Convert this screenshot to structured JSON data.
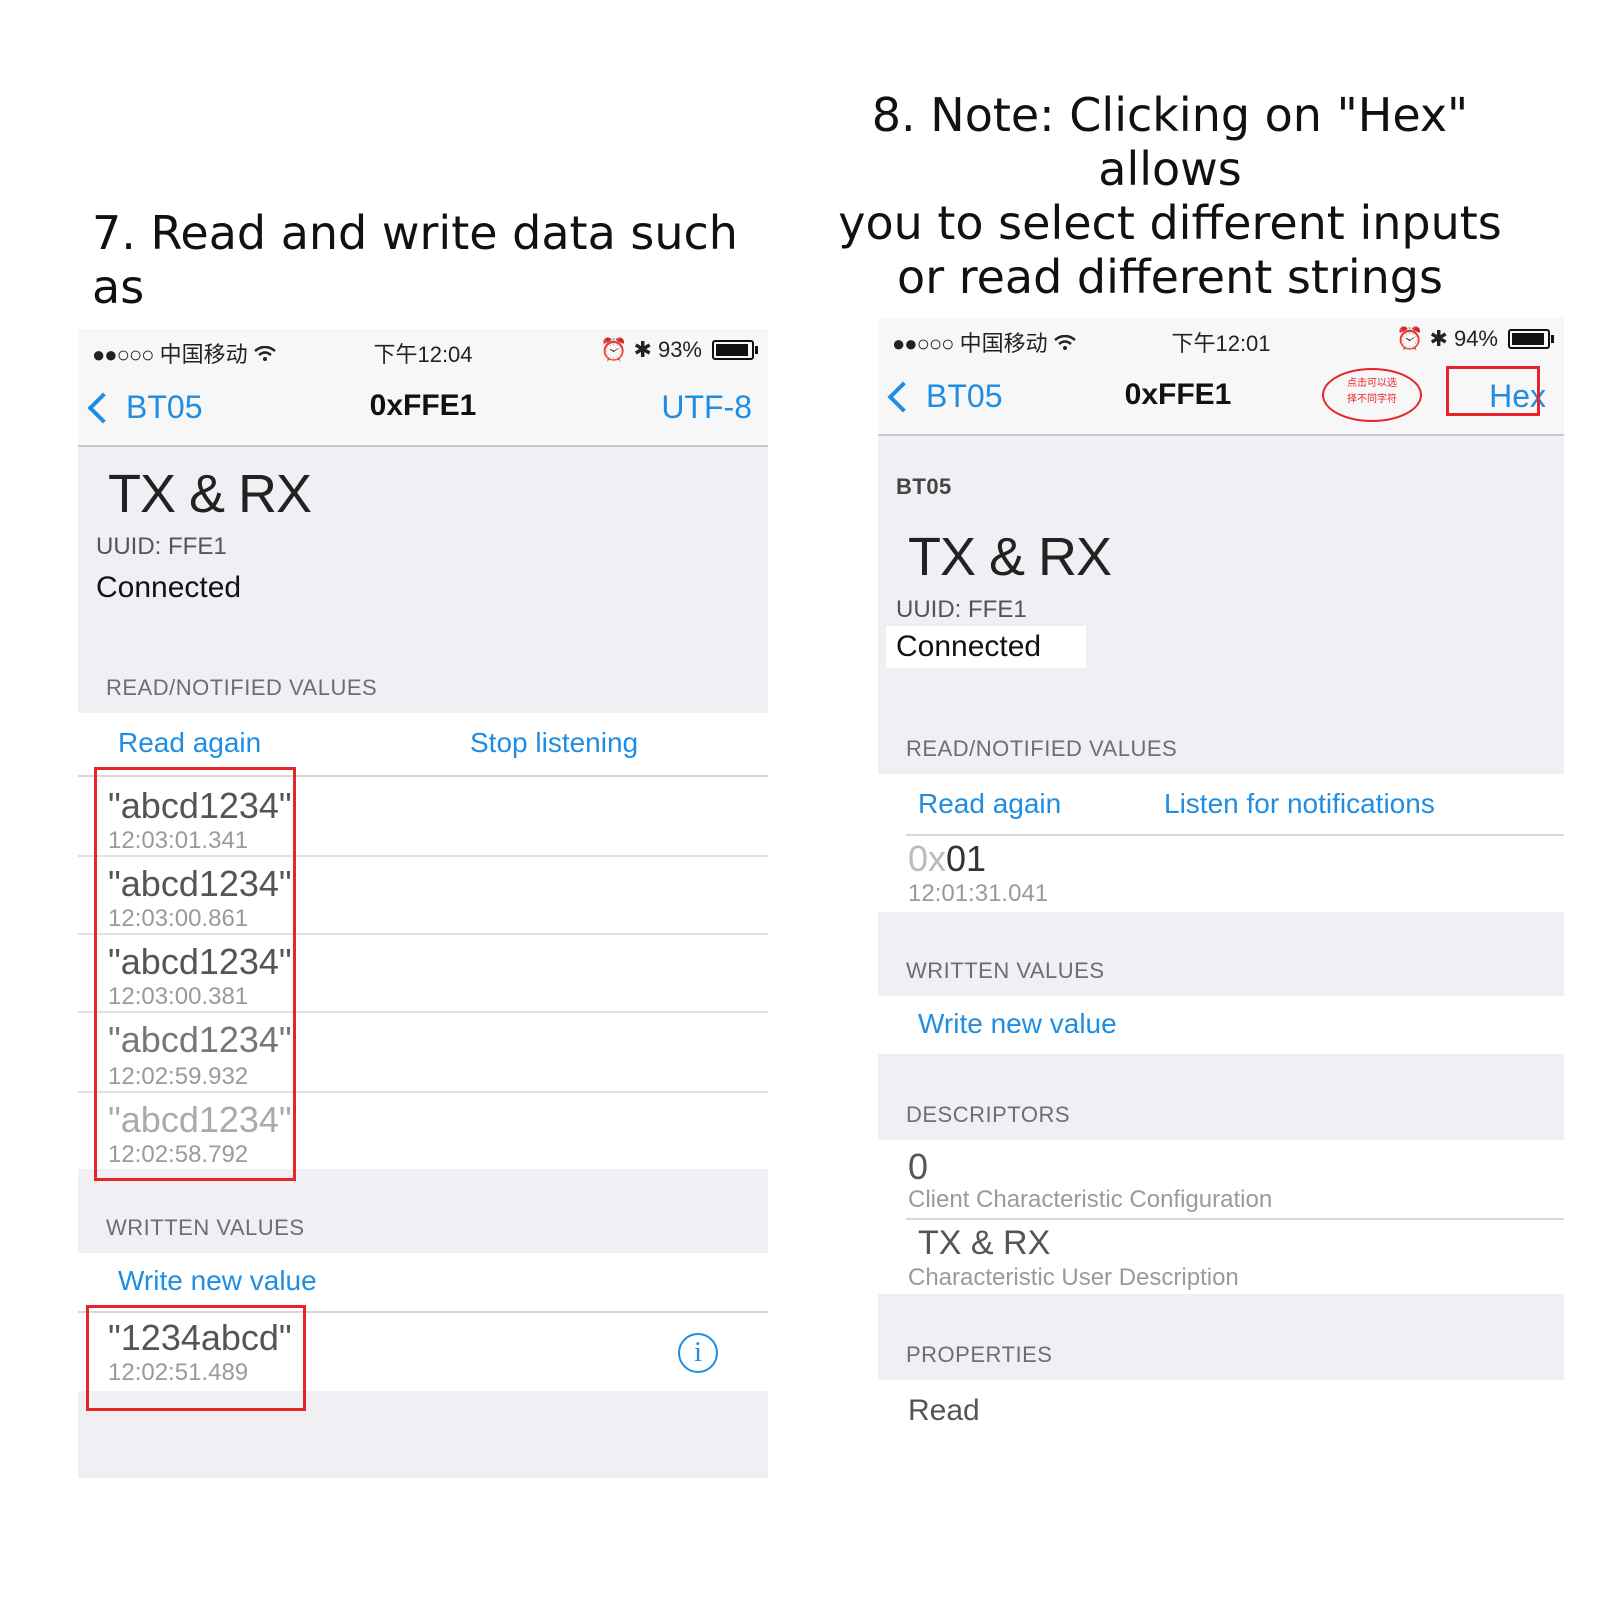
{
  "captions": {
    "step7": "7. Read and write data such as",
    "step8_line1": "8. Note: Clicking on \"Hex\" allows",
    "step8_line2": "you to select different inputs",
    "step8_line3": "or read different strings"
  },
  "left_phone": {
    "status": {
      "signal": "●●○○○",
      "carrier": "中国移动",
      "wifi": "wifi-icon",
      "time": "下午12:04",
      "battery": "93%",
      "battery_level": 0.93
    },
    "nav": {
      "back_label": "BT05",
      "title": "0xFFE1",
      "right_label": "UTF-8"
    },
    "characteristic": {
      "title": "TX & RX",
      "uuid": "UUID: FFE1",
      "status": "Connected"
    },
    "read_section": {
      "header": "READ/NOTIFIED VALUES",
      "read_again": "Read again",
      "stop_listening": "Stop listening",
      "values": [
        {
          "value": "\"abcd1234\"",
          "time": "12:03:01.341"
        },
        {
          "value": "\"abcd1234\"",
          "time": "12:03:00.861"
        },
        {
          "value": "\"abcd1234\"",
          "time": "12:03:00.381"
        },
        {
          "value": "\"abcd1234\"",
          "time": "12:02:59.932"
        },
        {
          "value": "\"abcd1234\"",
          "time": "12:02:58.792"
        }
      ]
    },
    "written_section": {
      "header": "WRITTEN VALUES",
      "write_new": "Write new value",
      "values": [
        {
          "value": "\"1234abcd\"",
          "time": "12:02:51.489"
        }
      ]
    }
  },
  "right_phone": {
    "status": {
      "signal": "●●○○○",
      "carrier": "中国移动",
      "wifi": "wifi-icon",
      "time": "下午12:01",
      "battery": "94%",
      "battery_level": 0.94
    },
    "nav": {
      "back_label": "BT05",
      "title": "0xFFE1",
      "right_label": "Hex",
      "bubble_line1": "点击可以选",
      "bubble_line2": "择不同字符"
    },
    "device_label": "BT05",
    "characteristic": {
      "title": "TX & RX",
      "uuid": "UUID: FFE1",
      "status": "Connected"
    },
    "read_section": {
      "header": "READ/NOTIFIED VALUES",
      "read_again": "Read again",
      "listen": "Listen for notifications",
      "values": [
        {
          "prefix": "0x",
          "value": "01",
          "time": "12:01:31.041"
        }
      ]
    },
    "written_section": {
      "header": "WRITTEN VALUES",
      "write_new": "Write new value"
    },
    "descriptors": {
      "header": "DESCRIPTORS",
      "items": [
        {
          "value": "0",
          "label": "Client Characteristic Configuration"
        },
        {
          "value": "TX & RX",
          "label": "Characteristic User Description"
        }
      ]
    },
    "properties": {
      "header": "PROPERTIES",
      "first_item": "Read"
    }
  }
}
